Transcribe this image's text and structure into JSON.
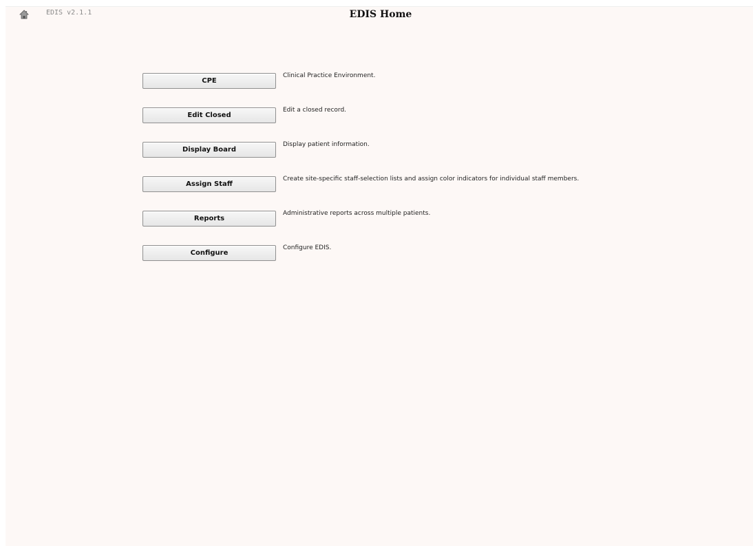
{
  "header": {
    "home_icon": "home-icon",
    "version": "EDIS v2.1.1",
    "title": "EDIS Home"
  },
  "menu": {
    "items": [
      {
        "label": "CPE",
        "description": "Clinical Practice Environment."
      },
      {
        "label": "Edit Closed",
        "description": "Edit a closed record."
      },
      {
        "label": "Display Board",
        "description": "Display patient information."
      },
      {
        "label": "Assign Staff",
        "description": "Create site-specific staff-selection lists and assign color indicators for individual staff members."
      },
      {
        "label": "Reports",
        "description": "Administrative reports across multiple patients."
      },
      {
        "label": "Configure",
        "description": "Configure EDIS."
      }
    ]
  },
  "colors": {
    "background": "#fdf8f6",
    "button_border": "#8f8f8f"
  }
}
